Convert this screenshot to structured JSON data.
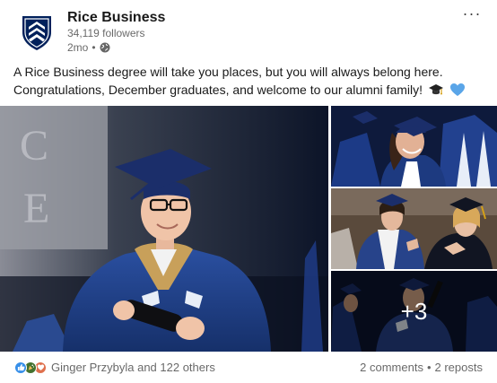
{
  "post": {
    "author": {
      "name": "Rice Business",
      "followers": "34,119 followers",
      "age": "2mo",
      "separator": "•"
    },
    "more_label": "···",
    "text_line1": "A Rice Business degree will take you places, but you will always belong here.",
    "text_line2": "Congratulations, December graduates, and welcome to our alumni family!",
    "emojis": [
      "graduation-cap-icon",
      "blue-heart-icon"
    ]
  },
  "gallery": {
    "more_count": "+3"
  },
  "social": {
    "reaction_icons": [
      "like-icon",
      "celebrate-icon",
      "love-icon"
    ],
    "reactors": "Ginger Przybyla and 122 others",
    "comments": "2 comments",
    "separator": "•",
    "reposts": "2 reposts"
  },
  "colors": {
    "brand_navy": "#00205b",
    "like_blue": "#378fe9",
    "celebrate_green": "#44712e",
    "love_red": "#df704d",
    "secondary_text": "#666666"
  }
}
